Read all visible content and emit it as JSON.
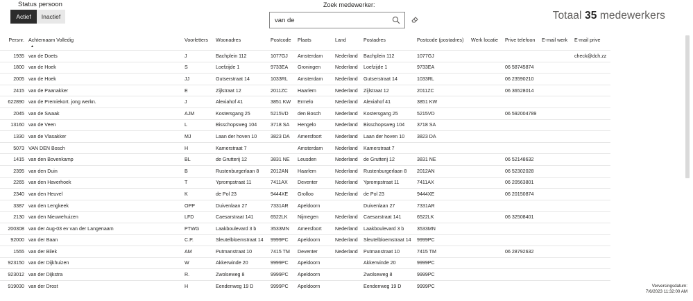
{
  "status": {
    "label": "Status persoon",
    "active_label": "Actief",
    "inactive_label": "Inactief"
  },
  "search": {
    "label": "Zoek medewerker:",
    "value": "van de"
  },
  "total": {
    "prefix": "Totaal",
    "count": "35",
    "suffix": "medewerkers"
  },
  "table": {
    "headers": [
      "Persnr.",
      "Achternaam Volledig",
      "Voorletters",
      "Woonadres",
      "Postcode",
      "Plaats",
      "Land",
      "Postadres",
      "Postcode (postadres)",
      "Werk locatie",
      "Prive telefoon",
      "E-mail werk",
      "E-mail prive"
    ],
    "rows": [
      [
        "1935",
        "van de Doets",
        "J",
        "Bachplein 112",
        "1077GJ",
        "Amsterdam",
        "Nederland",
        "Bachplein 112",
        "1077GJ",
        "",
        "",
        "",
        "check@dch.zz"
      ],
      [
        "1800",
        "van de Hoek",
        "S",
        "Loefzijde 1",
        "9733EA",
        "Groningen",
        "Nederland",
        "Loefzijde 1",
        "9733EA",
        "",
        "06 58745874",
        "",
        ""
      ],
      [
        "2005",
        "van de Hoek",
        "JJ",
        "Gutserstraat 14",
        "1033RL",
        "Amsterdam",
        "Nederland",
        "Gutserstraat 14",
        "1033RL",
        "",
        "06 23590210",
        "",
        ""
      ],
      [
        "2415",
        "van de Paanakker",
        "E",
        "Zijlstraat 12",
        "2011ZC",
        "Haarlem",
        "Nederland",
        "Zijlstraat 12",
        "2011ZC",
        "",
        "06 36528014",
        "",
        ""
      ],
      [
        "622890",
        "van de Premiekort. jong werkn.",
        "J",
        "Alexiahof 41",
        "3851 KW",
        "Ermelo",
        "Nederland",
        "Alexiahof 41",
        "3851 KW",
        "",
        "",
        "",
        ""
      ],
      [
        "2045",
        "van de Swaak",
        "AJM",
        "Kostersgang 25",
        "5215VD",
        "den Bosch",
        "Nederland",
        "Kostersgang 25",
        "5215VD",
        "",
        "06 592004789",
        "",
        ""
      ],
      [
        "13160",
        "van de Veen",
        "L",
        "Bisschopsweg 104",
        "3718 SA",
        "Hengelo",
        "Nederland",
        "Bisschopsweg 104",
        "3718 SA",
        "",
        "",
        "",
        ""
      ],
      [
        "1330",
        "van de Vlasakker",
        "MJ",
        "Laan der hoven 10",
        "3823 DA",
        "Amersfoort",
        "Nederland",
        "Laan der hoven 10",
        "3823 DA",
        "",
        "",
        "",
        ""
      ],
      [
        "5073",
        "VAN DEN Bosch",
        "H",
        "Kamerstraat 7",
        "",
        "Amsterdam",
        "Nederland",
        "Kamerstraat 7",
        "",
        "",
        "",
        "",
        ""
      ],
      [
        "1415",
        "van den Bovenkamp",
        "BL",
        "de Grutterij 12",
        "3831 NE",
        "Leusden",
        "Nederland",
        "de Grutterij 12",
        "3831 NE",
        "",
        "06 52148632",
        "",
        ""
      ],
      [
        "2395",
        "van den Duin",
        "B",
        "Rustenburgerlaan 8",
        "2012AN",
        "Haarlem",
        "Nederland",
        "Rustenburgerlaan 8",
        "2012AN",
        "",
        "06 52302028",
        "",
        ""
      ],
      [
        "2265",
        "van den Haverhoek",
        "T",
        "Yprompstraat 11",
        "7411AX",
        "Deventer",
        "Nederland",
        "Yprompstraat 11",
        "7411AX",
        "",
        "06 20563801",
        "",
        ""
      ],
      [
        "2340",
        "van den Heuvel",
        "K",
        "de Pol 23",
        "9444XE",
        "Grolloo",
        "Nederland",
        "de Pol 23",
        "9444XE",
        "",
        "06 20150874",
        "",
        ""
      ],
      [
        "3387",
        "van den Lengkeek",
        "OPP",
        "Duivenlaan 27",
        "7331AR",
        "Apeldoorn",
        "",
        "Duivenlaan 27",
        "7331AR",
        "",
        "",
        "",
        ""
      ],
      [
        "2130",
        "van den Nieuwehuizen",
        "LFD",
        "Caesarstraat 141",
        "6522LK",
        "Nijmegen",
        "Nederland",
        "Caesarstraat 141",
        "6522LK",
        "",
        "06 32508401",
        "",
        ""
      ],
      [
        "200308",
        "van der Aug-03 ev van der Langenaam",
        "PTWG",
        "Laakboulevard 3 b",
        "3533MN",
        "Amersfoort",
        "Nederland",
        "Laakboulevard 3 b",
        "3533MN",
        "",
        "",
        "",
        ""
      ],
      [
        "92000",
        "van der Baan",
        "C.P.",
        "Sleutelbloemstraat 14",
        "9999PC",
        "Apeldoorn",
        "Nederland",
        "Sleutelbloemstraat 14",
        "9999PC",
        "",
        "",
        "",
        ""
      ],
      [
        "1555",
        "van der Bilek",
        "AM",
        "Putmanstraat 10",
        "7415 TM",
        "Deventer",
        "Nederland",
        "Putmanstraat 10",
        "7415 TM",
        "",
        "06 28792632",
        "",
        ""
      ],
      [
        "923150",
        "van der Dijkhuizen",
        "W",
        "Akkerwinde 20",
        "9999PC",
        "Apeldoorn",
        "",
        "Akkerwinde 20",
        "9999PC",
        "",
        "",
        "",
        ""
      ],
      [
        "923012",
        "van der Dijkstra",
        "R.",
        "Zwolseweg 8",
        "9999PC",
        "Apeldoorn",
        "",
        "Zwolseweg 8",
        "9999PC",
        "",
        "",
        "",
        ""
      ],
      [
        "919030",
        "van der Drost",
        "H",
        "Eendenweg 19 D",
        "9999PC",
        "Apeldoorn",
        "",
        "Eendenweg 19 D",
        "9999PC",
        "",
        "",
        "",
        ""
      ]
    ]
  },
  "footer": {
    "label": "Verversingsdatum:",
    "value": "7/6/2023 11:32:00 AM"
  }
}
